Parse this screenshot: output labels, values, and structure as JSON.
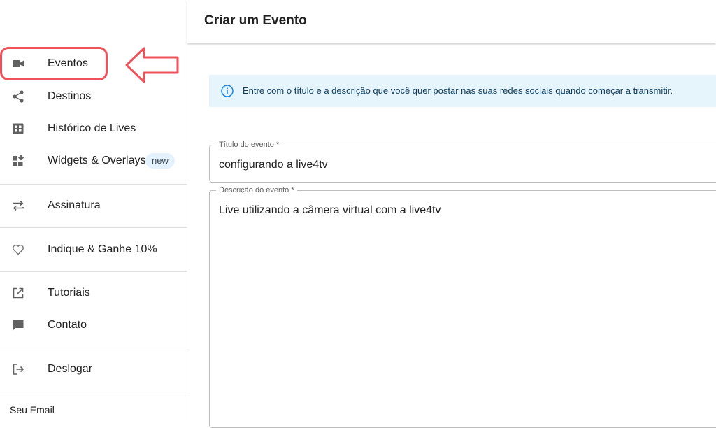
{
  "sidebar": {
    "items": [
      {
        "label": "Eventos",
        "icon": "video-camera-icon"
      },
      {
        "label": "Destinos",
        "icon": "share-icon"
      },
      {
        "label": "Histórico de Lives",
        "icon": "grid-history-icon"
      },
      {
        "label": "Widgets & Overlays",
        "icon": "widgets-icon",
        "badge": "new"
      },
      {
        "label": "Assinatura",
        "icon": "repeat-icon"
      },
      {
        "label": "Indique & Ganhe 10%",
        "icon": "heart-icon"
      },
      {
        "label": "Tutoriais",
        "icon": "external-link-icon"
      },
      {
        "label": "Contato",
        "icon": "chat-bubble-icon"
      },
      {
        "label": "Deslogar",
        "icon": "logout-icon"
      }
    ],
    "footer_label": "Seu Email"
  },
  "header": {
    "title": "Criar um Evento"
  },
  "info_banner": {
    "text": "Entre com o título e a descrição que você quer postar nas suas redes sociais quando começar a transmitir.",
    "icon": "info-icon"
  },
  "form": {
    "title_label": "Título do evento *",
    "title_value": "configurando a live4tv",
    "description_label": "Descrição do evento *",
    "description_value": "Live utilizando a câmera virtual com a live4tv"
  },
  "colors": {
    "annotation_red": "#f0525a",
    "info_bg": "#e6f4fb",
    "info_icon": "#1e88e5",
    "badge_bg": "#e3f2fd"
  }
}
